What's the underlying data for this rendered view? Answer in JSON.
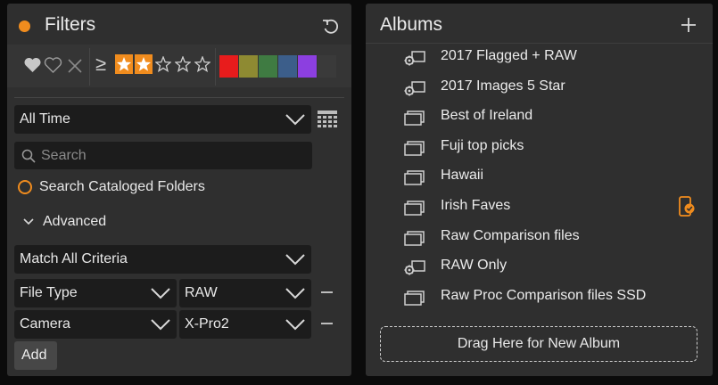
{
  "filters": {
    "title": "Filters",
    "flag_options": [
      "heart-filled-icon",
      "heart-outline-icon",
      "x-icon"
    ],
    "rating": {
      "operator": "≥",
      "stars_selected": 2,
      "stars_total": 5
    },
    "color_labels": [
      "#e81c1c",
      "#8e8a32",
      "#3f7b42",
      "#3c5e8a",
      "#8c3fe0",
      "#3a3a3a"
    ],
    "date_range": "All Time",
    "search_placeholder": "Search",
    "search_cataloged_folders": "Search Cataloged Folders",
    "advanced_label": "Advanced",
    "match_mode": "Match All Criteria",
    "criteria": [
      {
        "field": "File Type",
        "value": "RAW"
      },
      {
        "field": "Camera",
        "value": "X-Pro2"
      }
    ],
    "add_label": "Add",
    "accent_color": "#f08c1e"
  },
  "albums": {
    "title": "Albums",
    "items": [
      {
        "name": "2017 Flagged + RAW",
        "type": "smart"
      },
      {
        "name": "2017 Images 5 Star",
        "type": "smart"
      },
      {
        "name": "Best of Ireland",
        "type": "regular"
      },
      {
        "name": "Fuji top picks",
        "type": "regular"
      },
      {
        "name": "Hawaii",
        "type": "regular"
      },
      {
        "name": "Irish Faves",
        "type": "regular",
        "synced": true
      },
      {
        "name": "Raw Comparison files",
        "type": "regular"
      },
      {
        "name": "RAW Only",
        "type": "smart"
      },
      {
        "name": "Raw Proc Comparison files SSD",
        "type": "regular"
      }
    ],
    "drop_zone": "Drag Here for New Album"
  }
}
